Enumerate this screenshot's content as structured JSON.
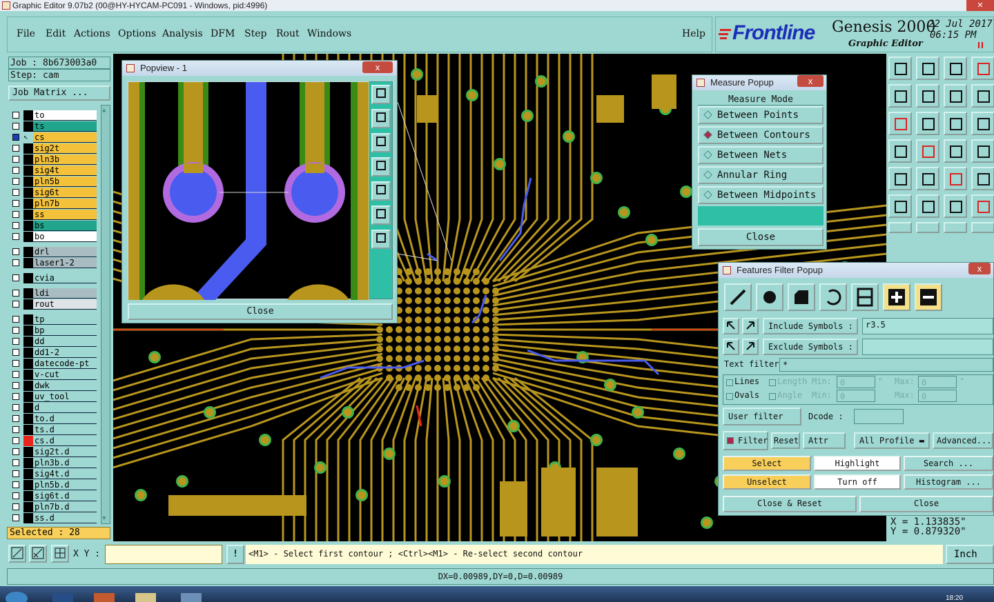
{
  "app": {
    "title": "Graphic Editor 9.07b2 (00@HY-HYCAM-PC091 - Windows, pid:4996)",
    "brand": "Frontline",
    "product": "Genesis 2000",
    "subtitle": "Graphic Editor",
    "date": "22 Jul 2017",
    "time": "06:15 PM"
  },
  "menu": [
    "File",
    "Edit",
    "Actions",
    "Options",
    "Analysis",
    "DFM",
    "Step",
    "Rout",
    "Windows"
  ],
  "help": "Help",
  "job": {
    "job": "Job : 8b673003a0",
    "step": "Step: cam",
    "matrix": "Job Matrix ..."
  },
  "layers": [
    {
      "name": "to",
      "bg": "#ffffff"
    },
    {
      "name": "ts",
      "bg": "#21a58c"
    },
    {
      "name": "cs",
      "bg": "#f3c13a"
    },
    {
      "name": "sig2t",
      "bg": "#f3c13a"
    },
    {
      "name": "pln3b",
      "bg": "#f3c13a"
    },
    {
      "name": "sig4t",
      "bg": "#f3c13a"
    },
    {
      "name": "pln5b",
      "bg": "#f3c13a"
    },
    {
      "name": "sig6t",
      "bg": "#f3c13a"
    },
    {
      "name": "pln7b",
      "bg": "#f3c13a"
    },
    {
      "name": "ss",
      "bg": "#f3c13a"
    },
    {
      "name": "bs",
      "bg": "#21a58c"
    },
    {
      "name": "bo",
      "bg": "#ffffff"
    },
    {
      "name": "drl",
      "bg": "#a8bcc2"
    },
    {
      "name": "laser1-2",
      "bg": "#a8bcc2"
    },
    {
      "name": "cvia",
      "bg": "#9fd8d2"
    },
    {
      "name": "ldi",
      "bg": "#a8bcc2"
    },
    {
      "name": "rout",
      "bg": "#dde3e6"
    },
    {
      "name": "tp",
      "bg": "#9fd8d2"
    },
    {
      "name": "bp",
      "bg": "#9fd8d2"
    },
    {
      "name": "dd",
      "bg": "#9fd8d2"
    },
    {
      "name": "dd1-2",
      "bg": "#9fd8d2"
    },
    {
      "name": "datecode-pt",
      "bg": "#9fd8d2"
    },
    {
      "name": "v-cut",
      "bg": "#9fd8d2"
    },
    {
      "name": "dwk",
      "bg": "#9fd8d2"
    },
    {
      "name": "uv_tool",
      "bg": "#9fd8d2"
    },
    {
      "name": "d",
      "bg": "#9fd8d2"
    },
    {
      "name": "to.d",
      "bg": "#9fd8d2"
    },
    {
      "name": "ts.d",
      "bg": "#9fd8d2"
    },
    {
      "name": "cs.d",
      "bg": "#9fd8d2"
    },
    {
      "name": "sig2t.d",
      "bg": "#9fd8d2"
    },
    {
      "name": "pln3b.d",
      "bg": "#9fd8d2"
    },
    {
      "name": "sig4t.d",
      "bg": "#9fd8d2"
    },
    {
      "name": "pln5b.d",
      "bg": "#9fd8d2"
    },
    {
      "name": "sig6t.d",
      "bg": "#9fd8d2"
    },
    {
      "name": "pln7b.d",
      "bg": "#9fd8d2"
    },
    {
      "name": "ss.d",
      "bg": "#9fd8d2"
    }
  ],
  "selected": "Selected : 28",
  "popview": {
    "title": "Popview - 1",
    "close": "Close",
    "close_x": "x"
  },
  "measure": {
    "title": "Measure Popup",
    "close_x": "x",
    "mode_label": "Measure Mode",
    "modes": [
      "Between Points",
      "Between Contours",
      "Between Nets",
      "Annular Ring",
      "Between Midpoints"
    ],
    "active_mode": "Between Contours",
    "close": "Close"
  },
  "ffilter": {
    "title": "Features Filter Popup",
    "close_x": "x",
    "include_label": "Include Symbols :",
    "include_value": "r3.5",
    "exclude_label": "Exclude Symbols :",
    "exclude_value": "",
    "text_filter_label": "Text filter",
    "text_filter_value": "*",
    "lines": "Lines",
    "ovals": "Ovals",
    "length": "Length",
    "angle": "Angle",
    "min": "Min:",
    "max": "Max:",
    "len_min": "0",
    "len_max": "0",
    "ang_min": "0",
    "ang_max": "0",
    "unit1": "\"",
    "unit2": "\"",
    "user_filter": "User filter ...",
    "dcode": "Dcode :",
    "dcode_value": "",
    "filter": "Filter",
    "reset": "Reset",
    "attr": "Attr ...",
    "all_profile": "All Profile",
    "advanced": "Advanced...",
    "select": "Select",
    "highlight": "Highlight",
    "search": "Search ...",
    "unselect": "Unselect",
    "turn_off": "Turn off",
    "histogram": "Histogram ...",
    "close_reset": "Close & Reset",
    "close": "Close"
  },
  "coords": {
    "x": "X = 1.133835\"",
    "y": "Y = 0.879320\""
  },
  "statusbar": {
    "xy_label": "X Y :",
    "xy_value": "",
    "message": "<M1> - Select first contour ; <Ctrl><M1> - Re-select second contour",
    "units": "Inch",
    "measurement": "DX=0.00989,DY=0,D=0.00989"
  },
  "taskbar": {
    "clock": "18:20"
  },
  "colors": {
    "panel": "#9fd8d2",
    "copper": "#b8961e",
    "pad_ring": "#3fb34b",
    "trace_blue": "#4a5cf0",
    "trace_red": "#e8261e",
    "highlight_yellow": "#f8cf5a"
  }
}
